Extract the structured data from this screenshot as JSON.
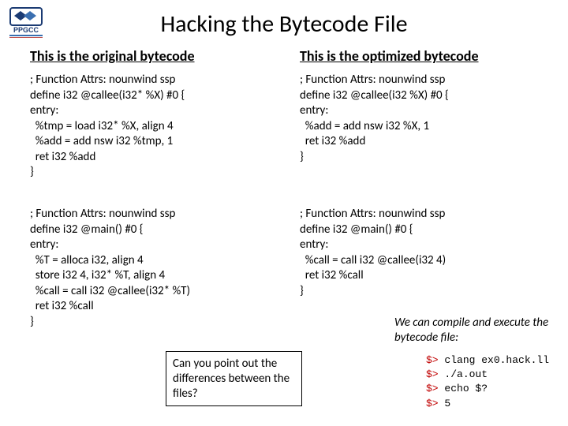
{
  "title": "Hacking the Bytecode File",
  "left_heading": "This is the original bytecode",
  "right_heading": "This is the optimized bytecode",
  "code_left_1": "; Function Attrs: nounwind ssp\ndefine i32 @callee(i32* %X) #0 {\nentry:\n  %tmp = load i32* %X, align 4\n  %add = add nsw i32 %tmp, 1\n  ret i32 %add\n}",
  "code_left_2": "; Function Attrs: nounwind ssp\ndefine i32 @main() #0 {\nentry:\n  %T = alloca i32, align 4\n  store i32 4, i32* %T, align 4\n  %call = call i32 @callee(i32* %T)\n  ret i32 %call\n}",
  "code_right_1": "; Function Attrs: nounwind ssp\ndefine i32 @callee(i32 %X) #0 {\nentry:\n  %add = add nsw i32 %X, 1\n  ret i32 %add\n}",
  "code_right_2": "; Function Attrs: nounwind ssp\ndefine i32 @main() #0 {\nentry:\n  %call = call i32 @callee(i32 4)\n  ret i32 %call\n}",
  "callout_question": "Can you point out the differences between the files?",
  "callout_note": "We can compile and execute the bytecode file:",
  "terminal": {
    "prompt": "$>",
    "lines": [
      "clang ex0.hack.ll",
      "./a.out",
      "echo $?",
      "5"
    ]
  }
}
